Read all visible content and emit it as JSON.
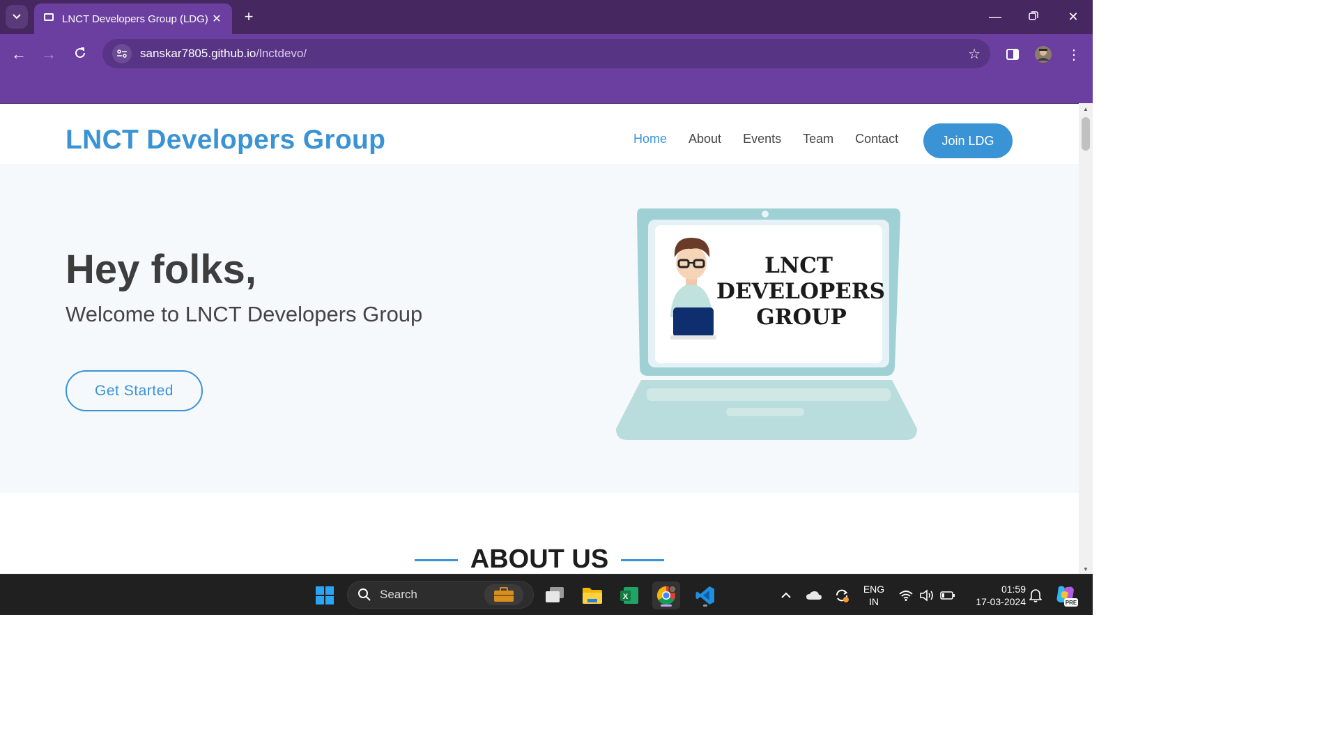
{
  "browser": {
    "tab_title": "LNCT Developers Group (LDG)",
    "url_host": "sanskar7805.github.io",
    "url_path": "/lnctdevo/"
  },
  "site": {
    "logo": "LNCT Developers Group",
    "nav": [
      "Home",
      "About",
      "Events",
      "Team",
      "Contact"
    ],
    "active_nav": "Home",
    "join_button": "Join LDG",
    "hero_title": "Hey folks,",
    "hero_subtitle": "Welcome to LNCT Developers Group",
    "cta_button": "Get Started",
    "illustration_text": [
      "LNCT",
      "DEVELOPERS",
      "GROUP"
    ],
    "section_heading": "ABOUT US"
  },
  "taskbar": {
    "search_placeholder": "Search",
    "lang_line1": "ENG",
    "lang_line2": "IN",
    "time": "01:59",
    "date": "17-03-2024",
    "copilot_badge": "PRE"
  },
  "colors": {
    "tabbar": "#46275f",
    "toolbar": "#6b3fa0",
    "brand_blue": "#3a93d4",
    "hero_bg": "#f5f9fc",
    "taskbar": "#202020"
  },
  "icons": [
    "tab-list-icon",
    "favicon-icon",
    "close-tab-icon",
    "new-tab-icon",
    "minimize-icon",
    "restore-icon",
    "window-close-icon",
    "back-icon",
    "forward-icon",
    "reload-icon",
    "site-info-icon",
    "bookmark-star-icon",
    "side-panel-icon",
    "profile-avatar-icon",
    "menu-kebab-icon",
    "windows-start-icon",
    "search-icon",
    "task-view-icon",
    "file-explorer-icon",
    "excel-icon",
    "chrome-icon",
    "vscode-icon",
    "chevron-up-icon",
    "onedrive-icon",
    "sync-icon",
    "wifi-icon",
    "volume-icon",
    "battery-icon",
    "notification-bell-icon",
    "copilot-icon"
  ]
}
